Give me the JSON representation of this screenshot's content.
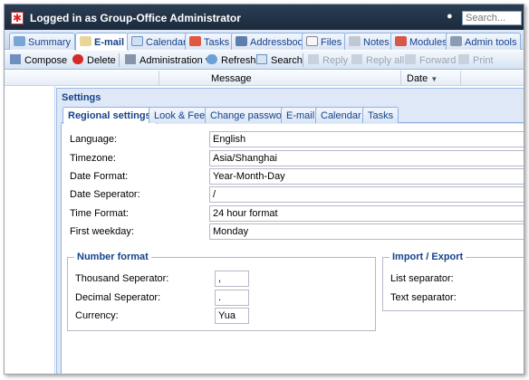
{
  "header": {
    "title": "Logged in as Group-Office Administrator",
    "search_placeholder": "Search..."
  },
  "module_tabs": [
    {
      "label": "Summary",
      "icon": "summary-icon"
    },
    {
      "label": "E-mail",
      "icon": "email-icon",
      "active": true
    },
    {
      "label": "Calendar",
      "icon": "calendar-icon"
    },
    {
      "label": "Tasks",
      "icon": "tasks-icon"
    },
    {
      "label": "Addressbook",
      "icon": "addressbook-icon"
    },
    {
      "label": "Files",
      "icon": "files-icon"
    },
    {
      "label": "Notes",
      "icon": "notes-icon"
    },
    {
      "label": "Modules",
      "icon": "modules-icon"
    },
    {
      "label": "Admin tools",
      "icon": "admin-tools-icon"
    }
  ],
  "toolbar": {
    "compose": "Compose",
    "delete": "Delete",
    "administration": "Administration",
    "refresh": "Refresh",
    "search": "Search",
    "reply": "Reply",
    "reply_all": "Reply all",
    "forward": "Forward",
    "print": "Print"
  },
  "grid": {
    "message_col": "Message",
    "date_col": "Date"
  },
  "settings": {
    "title": "Settings",
    "tabs": [
      {
        "label": "Regional settings",
        "active": true
      },
      {
        "label": "Look & Feel"
      },
      {
        "label": "Change password"
      },
      {
        "label": "E-mail"
      },
      {
        "label": "Calendar"
      },
      {
        "label": "Tasks"
      }
    ],
    "fields": [
      {
        "label": "Language:",
        "value": "English"
      },
      {
        "label": "Timezone:",
        "value": "Asia/Shanghai"
      },
      {
        "label": "Date Format:",
        "value": "Year-Month-Day"
      },
      {
        "label": "Date Seperator:",
        "value": "/"
      },
      {
        "label": "Time Format:",
        "value": "24 hour format"
      },
      {
        "label": "First weekday:",
        "value": "Monday"
      }
    ],
    "number_format": {
      "legend": "Number format",
      "fields": [
        {
          "label": "Thousand Seperator:",
          "value": ","
        },
        {
          "label": "Decimal Seperator:",
          "value": "."
        },
        {
          "label": "Currency:",
          "value": "Yua"
        }
      ]
    },
    "import_export": {
      "legend": "Import / Export",
      "fields": [
        {
          "label": "List separator:"
        },
        {
          "label": "Text separator:"
        }
      ]
    }
  },
  "colors": {
    "header_bg": "#1b2a3c",
    "accent": "#15428b",
    "panel_bg": "#dfe8f6",
    "border": "#99bbe8"
  }
}
